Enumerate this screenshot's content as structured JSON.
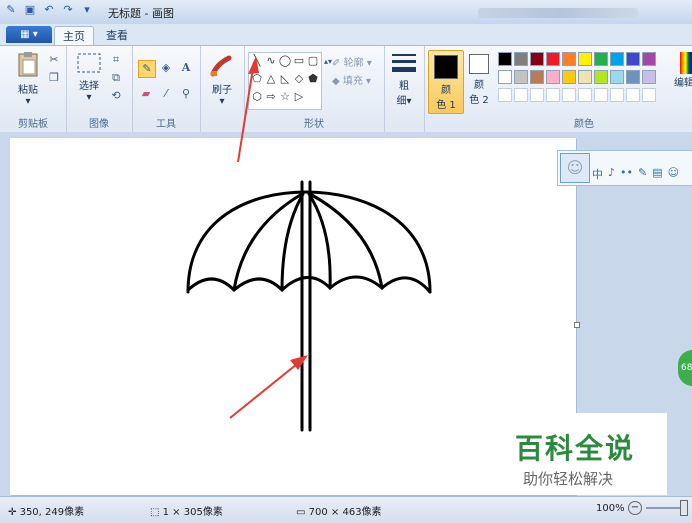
{
  "window": {
    "title": "无标题 - 画图"
  },
  "tabs": [
    {
      "label": "主页"
    },
    {
      "label": "查看"
    }
  ],
  "ribbon": {
    "clipboard": {
      "paste": "粘贴",
      "group": "剪贴板"
    },
    "image": {
      "select": "选择",
      "group": "图像"
    },
    "tools": {
      "group": "工具",
      "text_icon": "A"
    },
    "brush": {
      "label": "刷子"
    },
    "shapes": {
      "outline": "轮廓",
      "fill": "填充",
      "group": "形状"
    },
    "size": {
      "label_line1": "粗",
      "label_line2": "细"
    },
    "color1": {
      "line1": "颜",
      "line2": "色 1"
    },
    "color2": {
      "line1": "颜",
      "line2": "色 2"
    },
    "colors": {
      "group": "颜色",
      "edit_line1": "编辑"
    }
  },
  "palette": {
    "row1": [
      "#000000",
      "#7f7f7f",
      "#880015",
      "#ed1c24",
      "#ff7f27",
      "#fff200",
      "#22b14c",
      "#00a2e8",
      "#3f48cc",
      "#a349a4"
    ],
    "row2": [
      "#ffffff",
      "#c3c3c3",
      "#b97a57",
      "#ffaec9",
      "#ffc90e",
      "#efe4b0",
      "#b5e61d",
      "#99d9ea",
      "#7092be",
      "#c8bfe7"
    ],
    "row3": [
      "#ffffff",
      "#ffffff",
      "#ffffff",
      "#ffffff",
      "#ffffff",
      "#ffffff",
      "#ffffff",
      "#ffffff",
      "#ffffff",
      "#ffffff"
    ]
  },
  "colors_accent": {
    "selected_color1": "#000000",
    "selected_color2": "#ffffff",
    "annotation_arrow": "#e53935"
  },
  "statusbar": {
    "cursor_pos": "350, 249像素",
    "selection_size": "1 × 305像素",
    "image_size": "700 × 463像素",
    "zoom": "100%"
  },
  "qq_toolbar": {
    "items": [
      "中",
      "♪",
      "••",
      "✎",
      "▤",
      "☺"
    ]
  },
  "watermark": {
    "title": "百科全说",
    "subtitle": "助你轻松解决"
  },
  "side_badge": {
    "text": "68"
  }
}
